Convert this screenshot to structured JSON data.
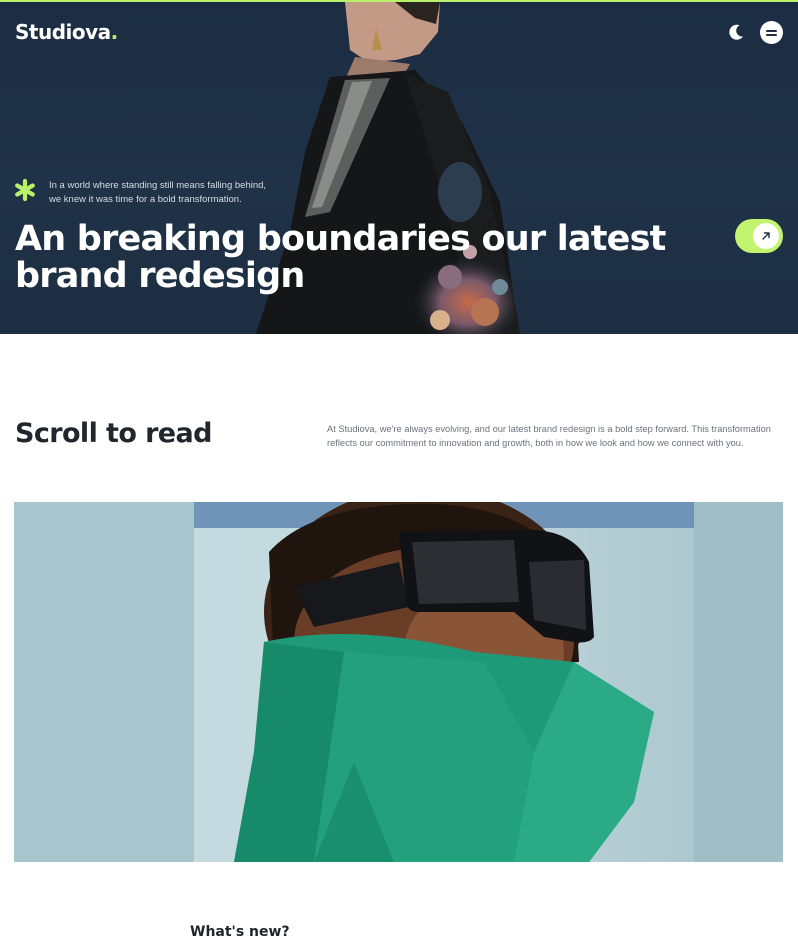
{
  "header": {
    "brand_name": "Studiova",
    "brand_dot": ".",
    "accent_color": "#b9f26a",
    "theme_toggle_icon": "moon-icon",
    "menu_icon": "menu-icon"
  },
  "hero": {
    "intro_line1": "In a world where standing still means falling behind,",
    "intro_line2": "we knew it was time for a bold transformation.",
    "title_line1": "An breaking boundaries our latest",
    "title_line2": "brand redesign",
    "cta_icon": "arrow-up-right-icon"
  },
  "intro_section": {
    "title": "Scroll to read",
    "body_line1": "At Studiova, we're always evolving, and our latest brand redesign is a bold step forward. This transformation",
    "body_line2": "reflects our commitment to innovation and growth, both in how we look and how we connect with you."
  },
  "next_section": {
    "title": "What's new?"
  }
}
